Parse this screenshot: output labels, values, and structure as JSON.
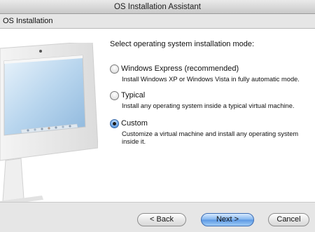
{
  "window": {
    "title": "OS Installation Assistant"
  },
  "header": {
    "section": "OS Installation"
  },
  "main": {
    "prompt": "Select operating system installation mode:",
    "options": [
      {
        "label": "Windows Express (recommended)",
        "description": "Install Windows XP or Windows Vista in fully automatic mode.",
        "selected": false
      },
      {
        "label": "Typical",
        "description": "Install any operating system inside a typical virtual machine.",
        "selected": false
      },
      {
        "label": "Custom",
        "description": "Customize a virtual machine and install any operating system inside it.",
        "selected": true
      }
    ]
  },
  "footer": {
    "back_label": "< Back",
    "next_label": "Next >",
    "cancel_label": "Cancel"
  },
  "colors": {
    "accent": "#5a97e3",
    "window_bg": "#e8e8e8"
  },
  "icons": {
    "illustration": "imac-display-illustration"
  }
}
